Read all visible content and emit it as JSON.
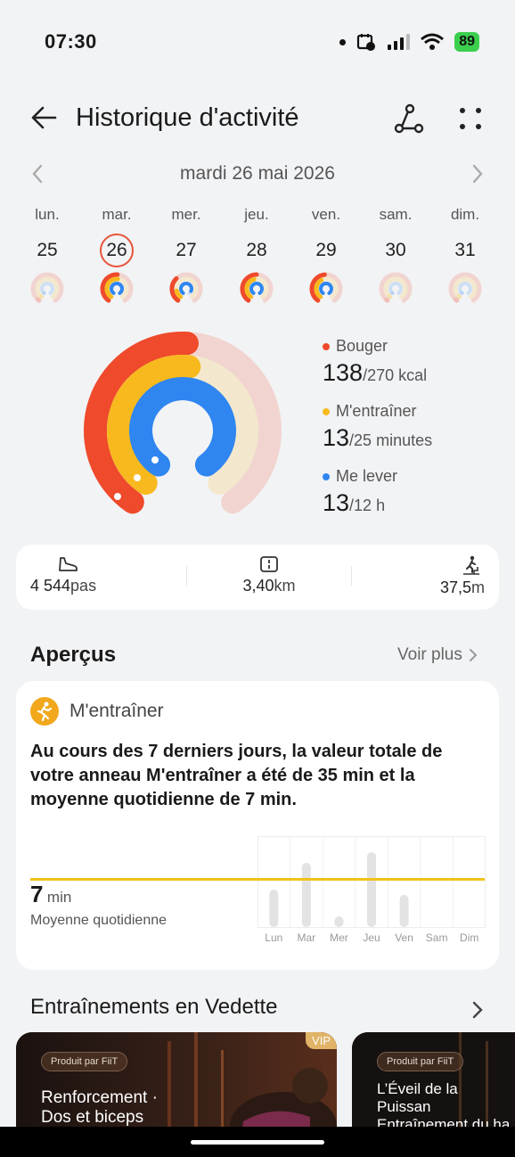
{
  "status_bar": {
    "time": "07:30",
    "battery": "89"
  },
  "header": {
    "title": "Historique d'activité"
  },
  "date_nav": {
    "date": "mardi 26 mai 2026"
  },
  "week": [
    {
      "name": "lun.",
      "num": "25",
      "selected": false,
      "faded": true
    },
    {
      "name": "mar.",
      "num": "26",
      "selected": true,
      "faded": false
    },
    {
      "name": "mer.",
      "num": "27",
      "selected": false,
      "faded": false
    },
    {
      "name": "jeu.",
      "num": "28",
      "selected": false,
      "faded": false
    },
    {
      "name": "ven.",
      "num": "29",
      "selected": false,
      "faded": false
    },
    {
      "name": "sam.",
      "num": "30",
      "selected": false,
      "faded": true
    },
    {
      "name": "dim.",
      "num": "31",
      "selected": false,
      "faded": true
    }
  ],
  "rings": {
    "bouger": {
      "label": "Bouger",
      "value": "138",
      "goal": "/270 kcal",
      "fraction": 0.51,
      "color": "#ef4a2b"
    },
    "entrainer": {
      "label": "M'entraîner",
      "value": "13",
      "goal": "/25 minutes",
      "fraction": 0.52,
      "color": "#f7b91e"
    },
    "lever": {
      "label": "Me lever",
      "value": "13",
      "goal": "/12 h",
      "fraction": 1.0,
      "color": "#2f86f0"
    }
  },
  "stats": {
    "steps": {
      "value": "4 544",
      "unit": "pas"
    },
    "distance": {
      "value": "3,40",
      "unit": "km"
    },
    "climb": {
      "value": "37,5",
      "unit": "m"
    }
  },
  "apercus": {
    "title": "Aperçus",
    "voir_plus": "Voir plus",
    "card_label": "M'entraîner",
    "text": "Au cours des 7 derniers jours, la valeur totale de votre anneau M'entraîner a été de 35 min et la moyenne quotidienne de 7 min.",
    "avg_value": "7",
    "avg_unit": "min",
    "avg_label": "Moyenne quotidienne",
    "chart_days": [
      "Lun",
      "Mar",
      "Mer",
      "Jeu",
      "Ven",
      "Sam",
      "Dim"
    ],
    "chart_values": [
      7,
      12,
      2,
      14,
      6,
      0,
      0
    ]
  },
  "featured": {
    "title": "Entraînements en Vedette",
    "cards": [
      {
        "badge": "Produit par FiiT",
        "title": "Renforcement ·\nDos et biceps",
        "vip": "VIP"
      },
      {
        "badge": "Produit par FiiT",
        "title": "L’Éveil de la Puissan\nEntraînement du ha\ncorps au poids du c"
      }
    ]
  },
  "colors": {
    "accent_red": "#ef4a2b",
    "accent_yellow": "#f7b91e",
    "accent_blue": "#2f86f0"
  }
}
